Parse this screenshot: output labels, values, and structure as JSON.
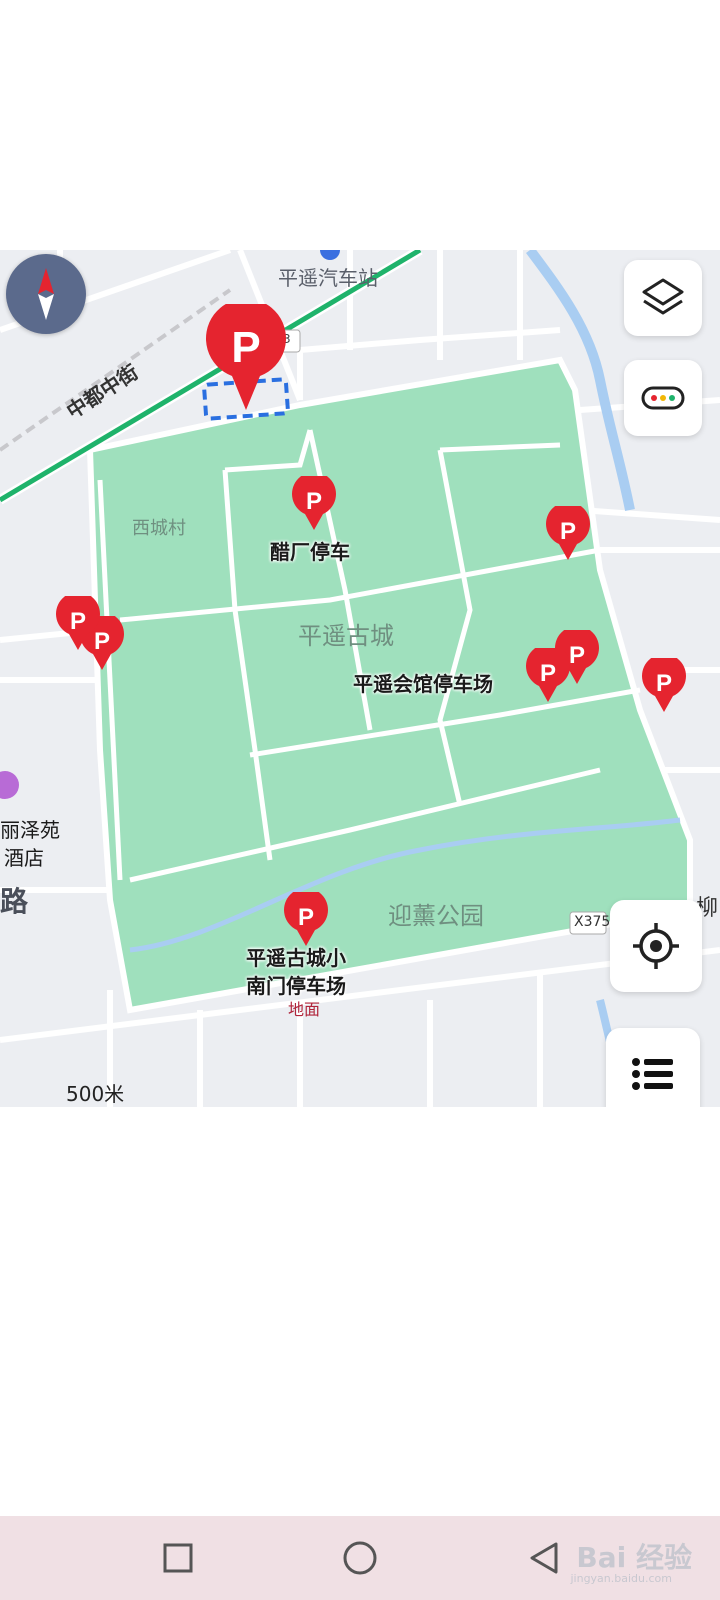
{
  "map": {
    "station_label": "平遥汽车站",
    "road_label": "中都中街",
    "road_shield": "3",
    "village_label": "西城村",
    "city_label": "平遥古城",
    "park_label": "迎薰公园",
    "hotel_label_1": "丽泽苑",
    "hotel_label_2": "酒店",
    "road_label_left": "路",
    "road_shield_x": "X375",
    "right_edge_label": "柳",
    "scale_label": "500米"
  },
  "parking": {
    "vinegar_label": "醋厂停车",
    "guild_label": "平遥会馆停车场",
    "south_gate_line1": "平遥古城小",
    "south_gate_line2": "南门停车场",
    "south_gate_sub": "地面",
    "pin_letter": "P"
  },
  "controls": {
    "layers_icon": "layers-icon",
    "traffic_icon": "traffic-icon",
    "locate_icon": "locate-icon",
    "list_icon": "list-icon",
    "compass_icon": "compass-icon"
  },
  "nav": {
    "recent_icon": "square-icon",
    "home_icon": "circle-icon",
    "back_icon": "triangle-back-icon"
  },
  "watermark": {
    "text": "Bai 经验",
    "sub": "jingyan.baidu.com"
  },
  "colors": {
    "park": "#9fe0bd",
    "pin": "#e5242f",
    "water": "#a9cdf2",
    "subway": "#1fb36b"
  }
}
